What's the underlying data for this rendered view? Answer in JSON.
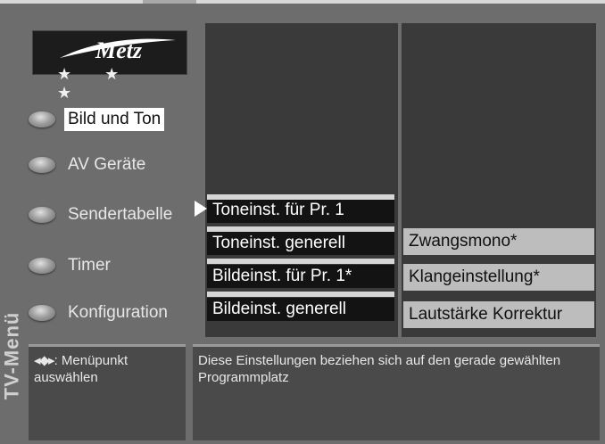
{
  "osd": {
    "title": "TV-Menü",
    "brand": "Metz",
    "stars": "★ ★ ★"
  },
  "main_menu": {
    "items": [
      {
        "label": "Bild und Ton",
        "active": true
      },
      {
        "label": "AV Geräte"
      },
      {
        "label": "Sendertabelle"
      },
      {
        "label": "Timer"
      },
      {
        "label": "Konfiguration"
      }
    ]
  },
  "submenu": {
    "items": [
      {
        "label": "Toneinst. für Pr. 1",
        "selected": true
      },
      {
        "label": "Toneinst. generell"
      },
      {
        "label": "Bildeinst. für Pr. 1*"
      },
      {
        "label": "Bildeinst. generell"
      }
    ]
  },
  "options": {
    "items": [
      {
        "label": "Zwangsmono*"
      },
      {
        "label": "Klangeinstellung*"
      },
      {
        "label": "Lautstärke Korrektur"
      }
    ]
  },
  "help": {
    "arrows": "◂⬥▸",
    "text_line1": ": Menüpunkt",
    "text_line2": "auswählen"
  },
  "description": {
    "text": "Diese Einstellungen beziehen sich auf den gerade gewählten Programmplatz"
  }
}
